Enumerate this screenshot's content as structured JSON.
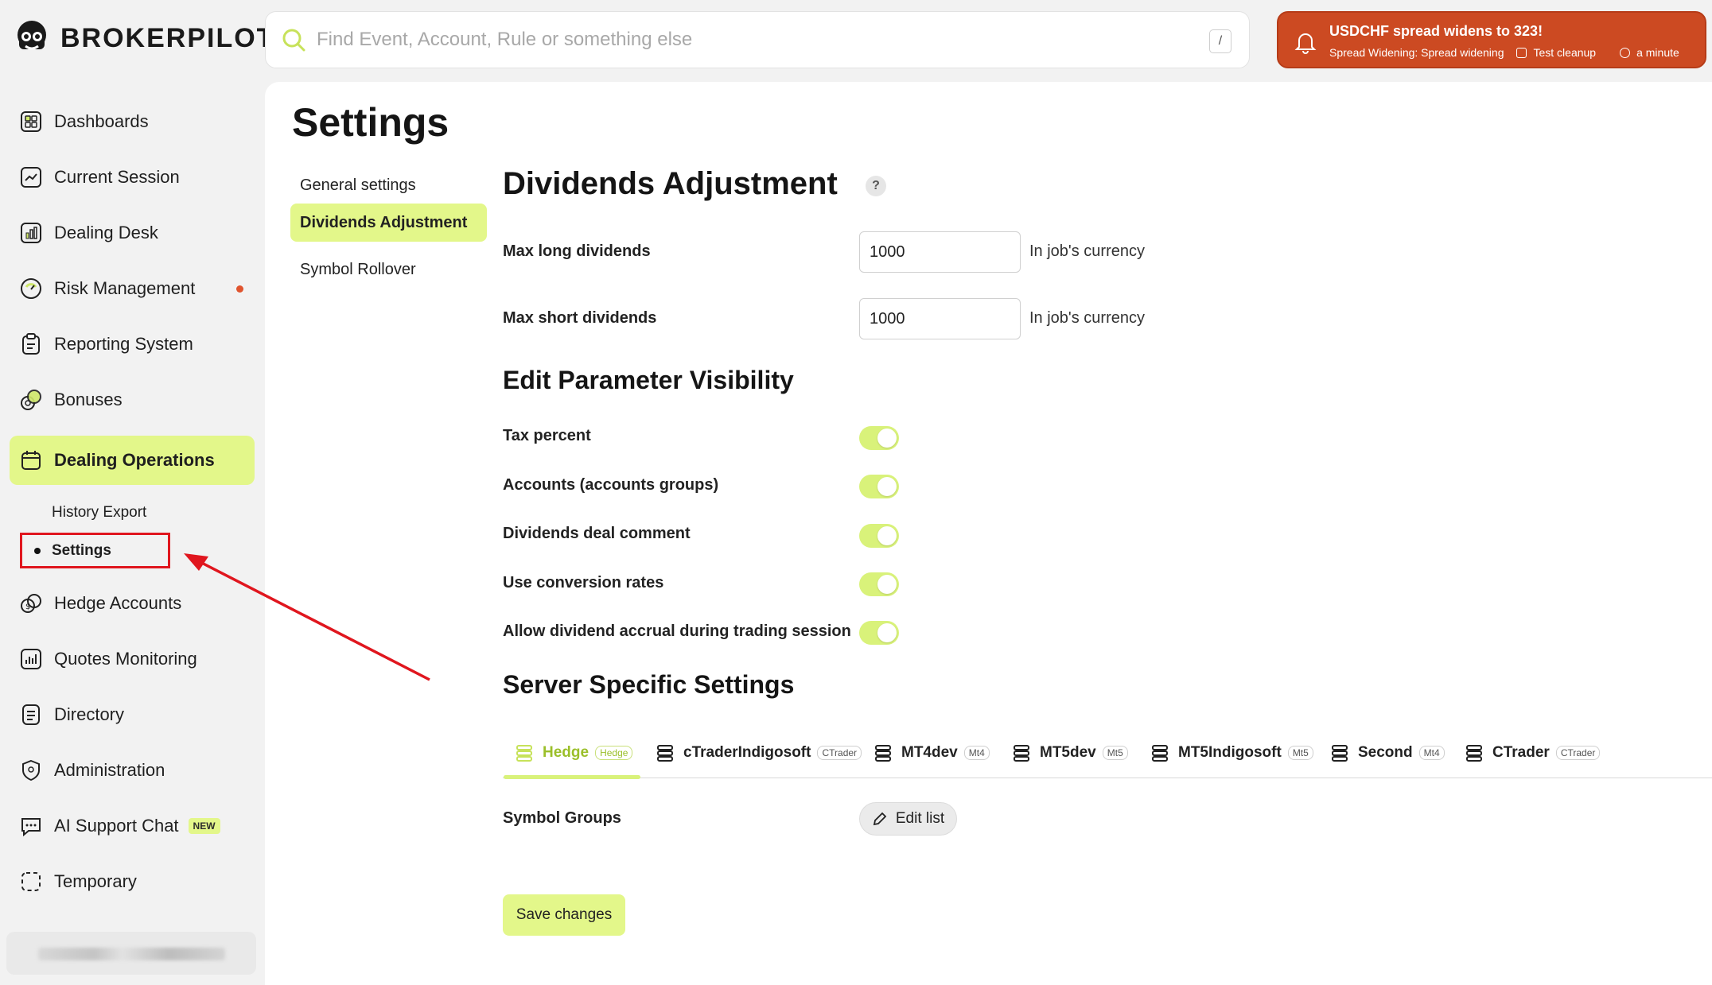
{
  "brand": {
    "name": "BROKERPILOT"
  },
  "search": {
    "placeholder": "Find Event, Account, Rule or something else",
    "shortcut": "/"
  },
  "notification": {
    "title": "USDCHF spread widens to 323!",
    "category": "Spread Widening: Spread widening",
    "source": "Test cleanup",
    "time": "a minute"
  },
  "sidebar": {
    "items": [
      {
        "label": "Dashboards",
        "icon": "dashboards-icon"
      },
      {
        "label": "Current Session",
        "icon": "chart-line-icon"
      },
      {
        "label": "Dealing Desk",
        "icon": "bar-chart-icon"
      },
      {
        "label": "Risk Management",
        "icon": "gauge-icon",
        "alert": true
      },
      {
        "label": "Reporting System",
        "icon": "clipboard-icon"
      },
      {
        "label": "Bonuses",
        "icon": "coins-icon"
      },
      {
        "label": "Dealing Operations",
        "icon": "calendar-icon",
        "active": true
      },
      {
        "label": "Hedge Accounts",
        "icon": "hedge-coins-icon"
      },
      {
        "label": "Quotes Monitoring",
        "icon": "monitor-chart-icon"
      },
      {
        "label": "Directory",
        "icon": "list-icon"
      },
      {
        "label": "Administration",
        "icon": "shield-icon"
      },
      {
        "label": "AI Support Chat",
        "icon": "chat-icon",
        "badge": "NEW"
      },
      {
        "label": "Temporary",
        "icon": "dashed-square-icon"
      }
    ],
    "sub_items": [
      {
        "label": "History Export"
      },
      {
        "label": "Settings",
        "active": true
      }
    ]
  },
  "page": {
    "title": "Settings",
    "tabs": [
      {
        "label": "General settings"
      },
      {
        "label": "Dividends Adjustment",
        "active": true
      },
      {
        "label": "Symbol Rollover"
      }
    ]
  },
  "dividends": {
    "heading": "Dividends Adjustment",
    "help": "?",
    "max_long_label": "Max long dividends",
    "max_long_value": "1000",
    "max_short_label": "Max short dividends",
    "max_short_value": "1000",
    "unit": "In job's currency"
  },
  "visibility": {
    "heading": "Edit Parameter Visibility",
    "params": [
      {
        "label": "Tax percent",
        "enabled": true
      },
      {
        "label": "Accounts (accounts groups)",
        "enabled": true
      },
      {
        "label": "Dividends deal comment",
        "enabled": true
      },
      {
        "label": "Use conversion rates",
        "enabled": true
      },
      {
        "label": "Allow dividend accrual during trading session",
        "enabled": true
      }
    ]
  },
  "server": {
    "heading": "Server Specific Settings",
    "tabs": [
      {
        "name": "Hedge",
        "badge": "Hedge",
        "active": true
      },
      {
        "name": "cTraderIndigosoft",
        "badge": "CTrader"
      },
      {
        "name": "MT4dev",
        "badge": "Mt4"
      },
      {
        "name": "MT5dev",
        "badge": "Mt5"
      },
      {
        "name": "MT5Indigosoft",
        "badge": "Mt5"
      },
      {
        "name": "Second",
        "badge": "Mt4"
      },
      {
        "name": "CTrader",
        "badge": "CTrader"
      }
    ],
    "symbol_groups_label": "Symbol Groups",
    "edit_list_label": "Edit list"
  },
  "actions": {
    "save_label": "Save changes"
  },
  "colors": {
    "accent": "#e3f78a",
    "notification": "#cc4a22",
    "annotation": "#e0161e"
  }
}
